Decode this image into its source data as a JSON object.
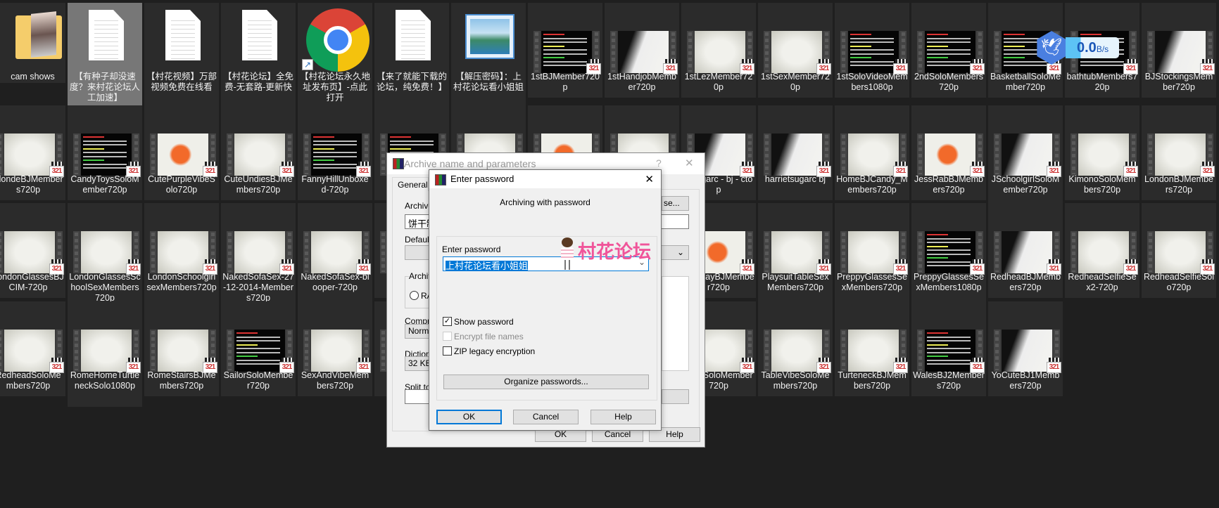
{
  "desktop": {
    "rows": [
      [
        {
          "name": "cam shows",
          "kind": "folder"
        },
        {
          "name": "【有种子却没速度？来村花论坛人工加速】",
          "kind": "doc",
          "selected": true
        },
        {
          "name": "【村花视频】万部视频免费在线看",
          "kind": "doc"
        },
        {
          "name": "【村花论坛】全免费-无套路-更新快",
          "kind": "doc"
        },
        {
          "name": "【村花论坛永久地址发布页】-点此打开",
          "kind": "chrome"
        },
        {
          "name": "【来了就能下载的论坛，纯免费！】",
          "kind": "doc"
        },
        {
          "name": "【解压密码】：上村花论坛看小姐姐",
          "kind": "photo"
        },
        {
          "name": "1stBJMember720p",
          "kind": "warning"
        },
        {
          "name": "1stHandjobMember720p",
          "kind": "ink"
        },
        {
          "name": "1stLezMember720p",
          "kind": "blank"
        },
        {
          "name": "1stSexMember720p",
          "kind": "blank"
        },
        {
          "name": "1stSoloVideoMembers1080p",
          "kind": "warning"
        },
        {
          "name": "2ndSoloMembers720p",
          "kind": "warning"
        },
        {
          "name": "BasketballSoloMember720p",
          "kind": "warning"
        },
        {
          "name": "bathtubMembers720p",
          "kind": "warning"
        },
        {
          "name": "BJStockingsMember720p",
          "kind": "ink"
        }
      ],
      [
        {
          "name": "BlondeBJMembers720p",
          "kind": "blank"
        },
        {
          "name": "CandyToysSoloMember720p",
          "kind": "warning"
        },
        {
          "name": "CutePurpleVibeSolo720p",
          "kind": "splash"
        },
        {
          "name": "CuteUndiesBJMembers720p",
          "kind": "blank"
        },
        {
          "name": "FannyHillUnboxed-720p",
          "kind": "warning"
        },
        {
          "name": "Fi",
          "kind": "warning"
        },
        {
          "name": "",
          "kind": "blank"
        },
        {
          "name": "",
          "kind": "splash"
        },
        {
          "name": "",
          "kind": "blank"
        },
        {
          "name": "etsugarc - bj - ctop",
          "kind": "ink"
        },
        {
          "name": "harrietsugarc bj",
          "kind": "ink"
        },
        {
          "name": "HomeBJCandy_Members720p",
          "kind": "blank"
        },
        {
          "name": "JessRabBJMembers720p",
          "kind": "splash"
        },
        {
          "name": "JSchoolgirlSoloMember720p",
          "kind": "ink"
        },
        {
          "name": "KimonoSoloMembers720p",
          "kind": "blank"
        },
        {
          "name": "LondonBJMembers720p",
          "kind": "blank"
        }
      ],
      [
        {
          "name": "LondonGlassesBJCIM-720p",
          "kind": "blank"
        },
        {
          "name": "LondonGlassesSchoolSexMembers720p",
          "kind": "blank"
        },
        {
          "name": "LondonSchoolgirlsexMembers720p",
          "kind": "blank"
        },
        {
          "name": "NakedSofaSex-27-12-2014-Members720p",
          "kind": "blank"
        },
        {
          "name": "NakedSofaSex-blooper-720p",
          "kind": "blank"
        },
        {
          "name": "N",
          "kind": "blank"
        },
        {
          "name": "",
          "kind": "blank"
        },
        {
          "name": "",
          "kind": "blank"
        },
        {
          "name": "",
          "kind": "blank"
        },
        {
          "name": "CosplayBJMember720p",
          "kind": "splash"
        },
        {
          "name": "PlaysuitTableSexMembers720p",
          "kind": "blank"
        },
        {
          "name": "PreppyGlassesSexMembers720p",
          "kind": "blank"
        },
        {
          "name": "PreppyGlassesSexMembers1080p",
          "kind": "warning"
        },
        {
          "name": "RedheadBJMembers720p",
          "kind": "ink"
        },
        {
          "name": "RedheadSelfieSex2-720p",
          "kind": "blank"
        },
        {
          "name": "RedheadSelfieSolo720p",
          "kind": "blank"
        }
      ],
      [
        {
          "name": "RedheadSoloMembers720p",
          "kind": "blank"
        },
        {
          "name": "RomeHomeTurtleneckSolo1080p",
          "kind": "blank"
        },
        {
          "name": "RomeStairsBJMembers720p",
          "kind": "blank"
        },
        {
          "name": "SailorSoloMember720p",
          "kind": "warning"
        },
        {
          "name": "SexAndVibeMembers720p",
          "kind": "blank"
        },
        {
          "name": "S",
          "kind": "blank"
        },
        {
          "name": "",
          "kind": "blank"
        },
        {
          "name": "",
          "kind": "blank"
        },
        {
          "name": "",
          "kind": "blank"
        },
        {
          "name": "nsuitSoloMember720p",
          "kind": "blank"
        },
        {
          "name": "TableVibeSoloMembers720p",
          "kind": "blank"
        },
        {
          "name": "TurteneckBJMembers720p",
          "kind": "blank"
        },
        {
          "name": "WalesBJ2Members720p",
          "kind": "warning"
        },
        {
          "name": "YoCuteBJ1Members720p",
          "kind": "ink"
        }
      ]
    ],
    "video_badge": "321"
  },
  "speed_widget": {
    "value": "0.0",
    "unit": "B/s"
  },
  "archive_dialog": {
    "title": "Archive name and parameters",
    "help_glyph": "?",
    "close_glyph": "✕",
    "tab_general": "General",
    "archive_label": "Archive",
    "archive_value": "饼干制",
    "browse_label": "se...",
    "default_label": "Default",
    "format_group": "Archiv",
    "format_rar": "RA",
    "compression_label": "Compre",
    "compression_value": "Normal",
    "dictionary_label": "Dictiona",
    "dictionary_value": "32 KB",
    "split_label": "Split to",
    "ok": "OK",
    "cancel": "Cancel",
    "help": "Help"
  },
  "password_dialog": {
    "title": "Enter password",
    "close_glyph": "✕",
    "heading": "Archiving with password",
    "field_label": "Enter password",
    "password_value": "上村花论坛看小姐姐",
    "show_password": {
      "label": "Show password",
      "checked": true
    },
    "encrypt_names": {
      "label": "Encrypt file names",
      "checked": false,
      "disabled": true
    },
    "zip_legacy": {
      "label": "ZIP legacy encryption",
      "checked": false
    },
    "organize": "Organize passwords...",
    "ok": "OK",
    "cancel": "Cancel",
    "help": "Help"
  },
  "watermark": {
    "text": "村花论坛",
    "color": "#f0559a"
  }
}
